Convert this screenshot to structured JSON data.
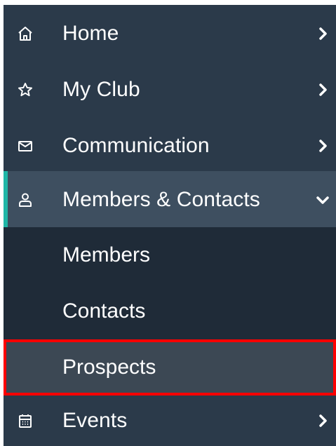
{
  "nav": {
    "items": [
      {
        "label": "Home",
        "icon": "home-icon",
        "indicator": "chevron-right"
      },
      {
        "label": "My Club",
        "icon": "star-icon",
        "indicator": "chevron-right"
      },
      {
        "label": "Communication",
        "icon": "envelope-icon",
        "indicator": "chevron-right"
      },
      {
        "label": "Members & Contacts",
        "icon": "user-icon",
        "indicator": "chevron-down",
        "expanded": true
      },
      {
        "label": "Events",
        "icon": "calendar-icon",
        "indicator": "chevron-right"
      }
    ],
    "submenu": [
      {
        "label": "Members"
      },
      {
        "label": "Contacts"
      },
      {
        "label": "Prospects",
        "selected": true
      }
    ]
  },
  "colors": {
    "sidebar_bg": "#2b3a4a",
    "submenu_bg": "#1f2b38",
    "expanded_bg": "#3e4f60",
    "accent": "#1fb6a6",
    "highlight_border": "#ff0000"
  }
}
